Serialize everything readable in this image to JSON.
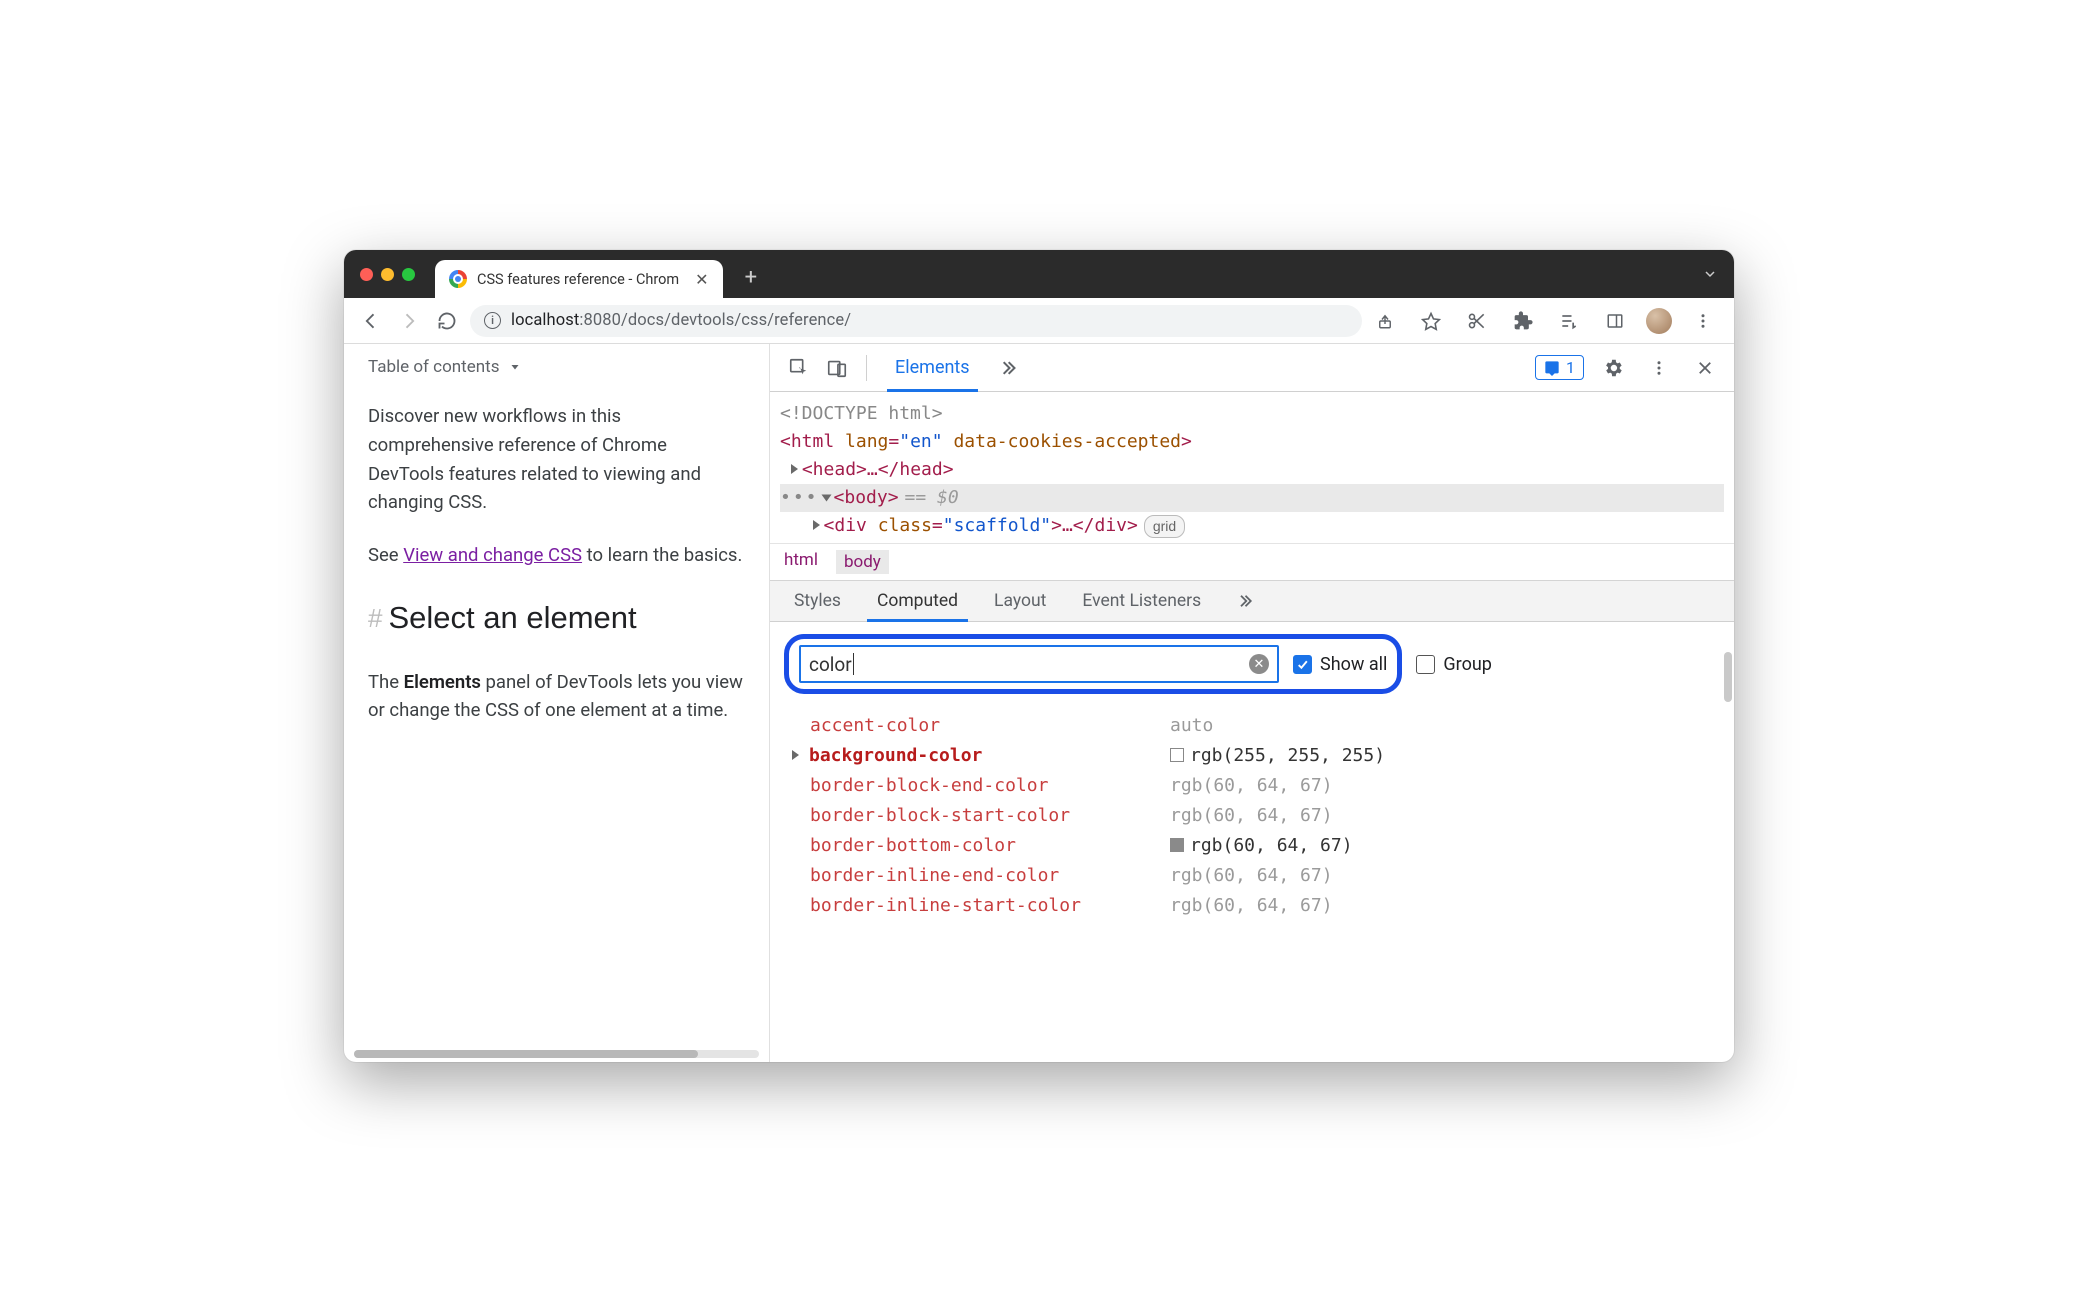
{
  "browser": {
    "tab_title": "CSS features reference - Chrom",
    "url_host": "localhost",
    "url_port": ":8080",
    "url_path": "/docs/devtools/css/reference/"
  },
  "page": {
    "toc_label": "Table of contents",
    "intro": "Discover new workflows in this comprehensive reference of Chrome DevTools features related to viewing and changing CSS.",
    "see_prefix": "See ",
    "see_link": "View and change CSS",
    "see_suffix": " to learn the basics.",
    "h2": "Select an element",
    "body_p_prefix": "The ",
    "body_p_bold": "Elements",
    "body_p_suffix": " panel of DevTools lets you view or change the CSS of one element at a time."
  },
  "devtools": {
    "tabs": {
      "elements": "Elements"
    },
    "issues_count": "1",
    "dom": {
      "doctype": "<!DOCTYPE html>",
      "html_open": "<html",
      "lang_attr": "lang",
      "lang_val": "\"en\"",
      "cookies_attr": "data-cookies-accepted",
      "head": "<head>…</head>",
      "body": "<body>",
      "eq0": "== $0",
      "div_open": "<div",
      "class_attr": "class",
      "class_val": "\"scaffold\"",
      "div_close": "…</div>",
      "grid_badge": "grid"
    },
    "breadcrumb": [
      "html",
      "body"
    ],
    "subtabs": [
      "Styles",
      "Computed",
      "Layout",
      "Event Listeners"
    ],
    "filter_value": "color",
    "show_all_label": "Show all",
    "group_label": "Group",
    "properties": [
      {
        "name": "accent-color",
        "value": "auto",
        "dim": true
      },
      {
        "name": "background-color",
        "value": "rgb(255, 255, 255)",
        "bold": true,
        "tri": true,
        "swatch": "white"
      },
      {
        "name": "border-block-end-color",
        "value": "rgb(60, 64, 67)",
        "dim": true
      },
      {
        "name": "border-block-start-color",
        "value": "rgb(60, 64, 67)",
        "dim": true
      },
      {
        "name": "border-bottom-color",
        "value": "rgb(60, 64, 67)",
        "swatch": "gray"
      },
      {
        "name": "border-inline-end-color",
        "value": "rgb(60, 64, 67)",
        "dim": true
      },
      {
        "name": "border-inline-start-color",
        "value": "rgb(60, 64, 67)",
        "dim": true
      }
    ]
  }
}
